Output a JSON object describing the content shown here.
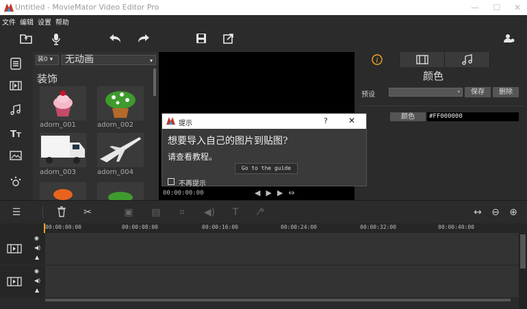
{
  "window": {
    "title": "Untitled - MovieMator Video Editor Pro",
    "minimize": "—",
    "maximize": "☐",
    "close": "✕"
  },
  "menu": [
    "文件",
    "编辑",
    "设置",
    "帮助"
  ],
  "library": {
    "category_combo": "装0",
    "filter_combo": "无动画",
    "heading": "装饰",
    "items": [
      "adorn_001",
      "adorn_002",
      "adorn_003",
      "adorn_004"
    ]
  },
  "right_panel": {
    "title": "颜色",
    "preset_label": "预设",
    "save_button": "保存",
    "delete_button": "删除",
    "color_button": "颜色",
    "color_value": "#FF000000"
  },
  "preview": {
    "timecode": "00:00:00:00"
  },
  "dialog": {
    "title": "提示",
    "help": "?",
    "close": "✕",
    "message": "想要导入自己的图片到贴图?",
    "submessage": "请查看教程。",
    "guide_button": "Go to the guide",
    "dont_show": "不再提示"
  },
  "timeline": {
    "ticks": [
      "00:00:00:00",
      "00:00:08:00",
      "00:00:16:00",
      "00:00:24:00",
      "00:00:32:00",
      "00:00:40:00"
    ]
  },
  "colors": {
    "accent": "#f5a623",
    "panel": "#2b2b2b",
    "dark": "#303030"
  }
}
